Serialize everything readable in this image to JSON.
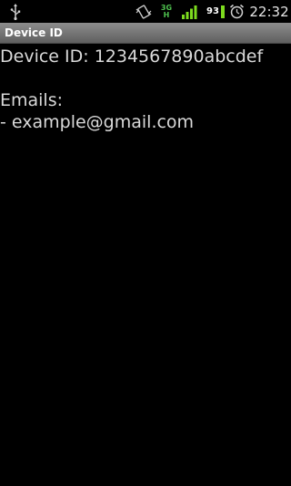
{
  "status_bar": {
    "time": "22:32",
    "battery_level": "93",
    "network_type_top": "3G",
    "network_type_bottom": "H",
    "icons": [
      "usb-icon",
      "vibrate-icon",
      "hspa-icon",
      "signal-icon",
      "battery-icon",
      "alarm-icon"
    ],
    "colors": {
      "signal": "#7ddb1e",
      "network": "#4fc34f"
    }
  },
  "title_bar": {
    "title": "Device ID"
  },
  "content": {
    "device_id_line": "Device ID: 1234567890abcdef",
    "emails_heading": "Emails:",
    "emails": [
      "- example@gmail.com"
    ]
  }
}
